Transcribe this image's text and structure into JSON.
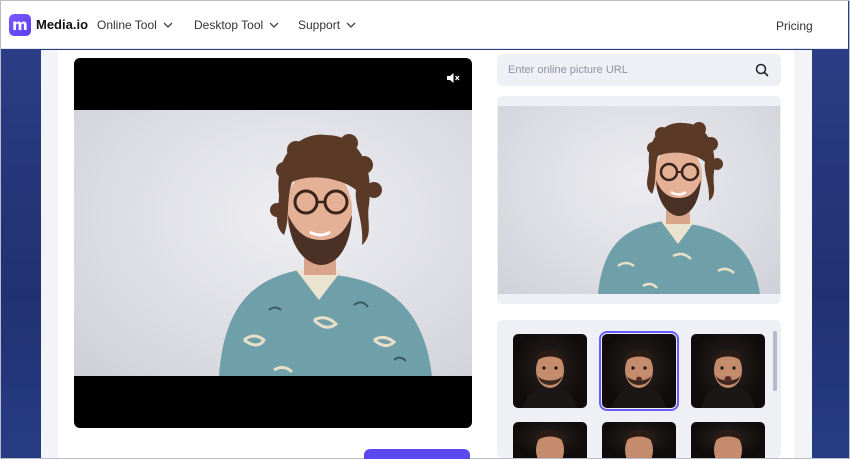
{
  "brand": {
    "name": "Media.io",
    "logo_glyph": "m",
    "accent": "#6b5cff"
  },
  "nav": {
    "items": [
      {
        "label": "Online Tool"
      },
      {
        "label": "Desktop Tool"
      },
      {
        "label": "Support"
      }
    ],
    "pricing": "Pricing"
  },
  "player": {
    "mute_icon": "speaker-muted-icon"
  },
  "url_input": {
    "placeholder": "Enter online picture URL",
    "value": ""
  },
  "templates": {
    "count_visible": 6,
    "selected_index": 1
  }
}
